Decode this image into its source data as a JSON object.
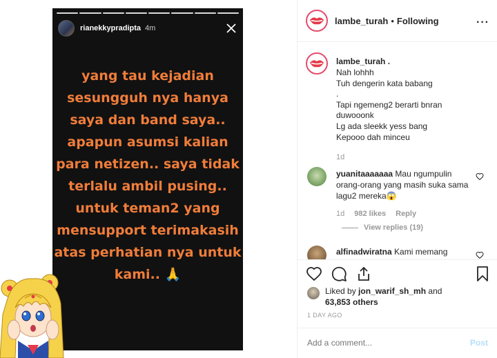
{
  "story": {
    "username": "rianekkypradipta",
    "time": "4m",
    "lines": [
      "yang tau kejadian",
      "sesungguh nya hanya",
      "saya dan band saya..",
      "apapun asumsi kalian",
      "para netizen.. saya tidak",
      "terlalu ambil pusing..",
      "untuk teman2 yang",
      "mensupport terimakasih",
      "atas perhatian nya untuk",
      "kami.. 🙏"
    ],
    "text_color": "#f07d3a"
  },
  "header": {
    "username": "lambe_turah",
    "separator": "•",
    "follow_status": "Following",
    "more": "···"
  },
  "caption": {
    "username": "lambe_turah .",
    "lines": [
      "Nah lohhh",
      "Tuh dengerin kata babang",
      ".",
      "Tapi ngemeng2 berarti bnran",
      "duwooonk",
      "Lg ada sleekk yess bang",
      "Kepooo dah minceu"
    ],
    "age": "1d"
  },
  "comment1": {
    "username": "yuanitaaaaaaa",
    "text": "Mau ngumpulin orang-orang yang masih suka sama lagu2 mereka😱",
    "age": "1d",
    "likes": "982 likes",
    "reply": "Reply",
    "view_replies": "View replies (19)"
  },
  "comment2": {
    "username": "alfinadwiratna",
    "text": "Kami memang"
  },
  "likes": {
    "prefix": "Liked by ",
    "user": "jon_warif_sh_mh",
    "and": " and",
    "others": "63,853 others"
  },
  "timestamp": "1 DAY AGO",
  "add_comment": {
    "placeholder": "Add a comment...",
    "post_label": "Post"
  },
  "colors": {
    "accent": "#e34b6c",
    "post_disabled": "#b2dffc"
  }
}
